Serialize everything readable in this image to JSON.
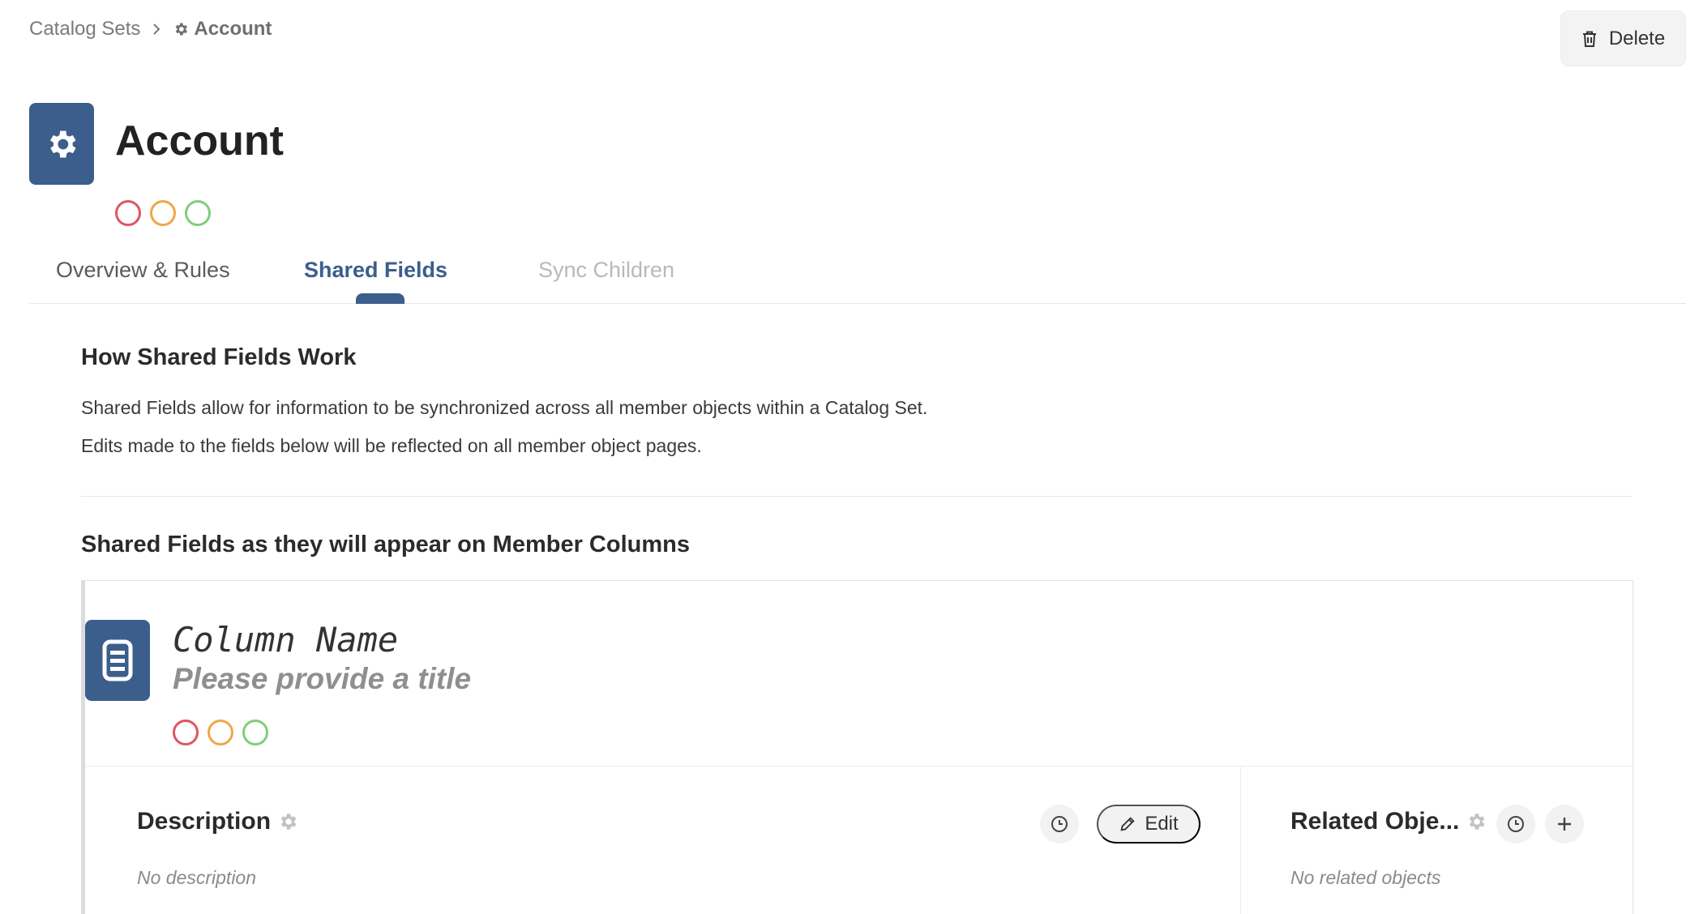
{
  "breadcrumb": {
    "parent": "Catalog Sets",
    "current": "Account"
  },
  "header": {
    "title": "Account",
    "icon": "gear-icon",
    "delete_label": "Delete"
  },
  "status_colors": [
    "#e05561",
    "#f1a64a",
    "#7fce7a"
  ],
  "tabs": [
    {
      "label": "Overview & Rules",
      "state": "normal"
    },
    {
      "label": "Shared Fields",
      "state": "active"
    },
    {
      "label": "Sync Children",
      "state": "disabled"
    }
  ],
  "how_section": {
    "heading": "How Shared Fields Work",
    "line1": "Shared Fields allow for information to be synchronized across all member objects within a Catalog Set.",
    "line2": "Edits made to the fields below will be reflected on all member object pages."
  },
  "preview_section": {
    "heading": "Shared Fields as they will appear on Member Columns",
    "column_name": "Column Name",
    "column_subtitle": "Please provide a title",
    "description": {
      "title": "Description",
      "empty_text": "No description",
      "edit_label": "Edit"
    },
    "related": {
      "title": "Related Obje...",
      "empty_text": "No related objects"
    }
  },
  "accent_color": "#3b5e8d"
}
